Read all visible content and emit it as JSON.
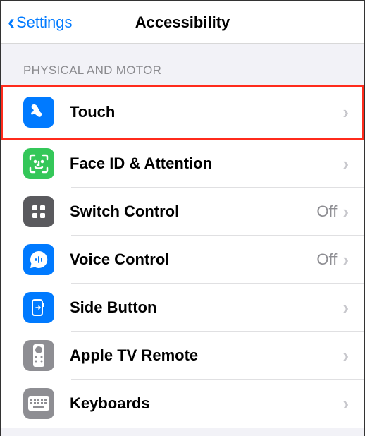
{
  "header": {
    "back_label": "Settings",
    "title": "Accessibility"
  },
  "section": {
    "title": "PHYSICAL AND MOTOR"
  },
  "items": [
    {
      "label": "Touch",
      "value": "",
      "highlighted": true
    },
    {
      "label": "Face ID & Attention",
      "value": ""
    },
    {
      "label": "Switch Control",
      "value": "Off"
    },
    {
      "label": "Voice Control",
      "value": "Off"
    },
    {
      "label": "Side Button",
      "value": ""
    },
    {
      "label": "Apple TV Remote",
      "value": ""
    },
    {
      "label": "Keyboards",
      "value": ""
    }
  ]
}
